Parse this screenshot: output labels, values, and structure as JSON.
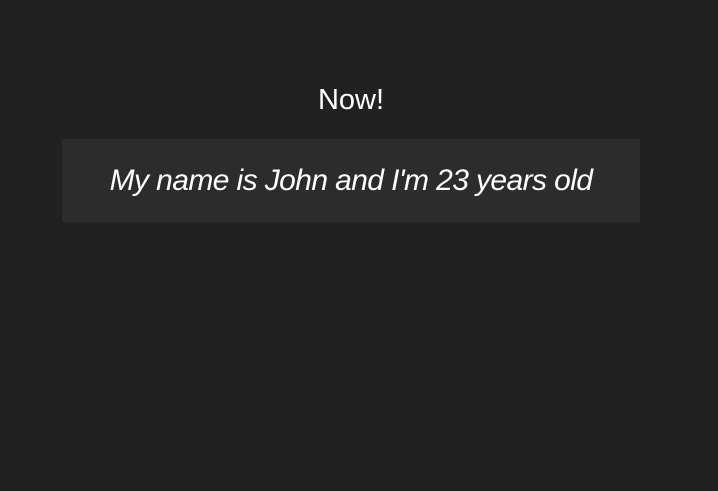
{
  "heading": {
    "text": "Now!"
  },
  "output": {
    "text": "My name is John and I'm 23 years old"
  },
  "colors": {
    "background": "#212121",
    "box_background": "#2c2c2c",
    "text": "#ffffff"
  }
}
